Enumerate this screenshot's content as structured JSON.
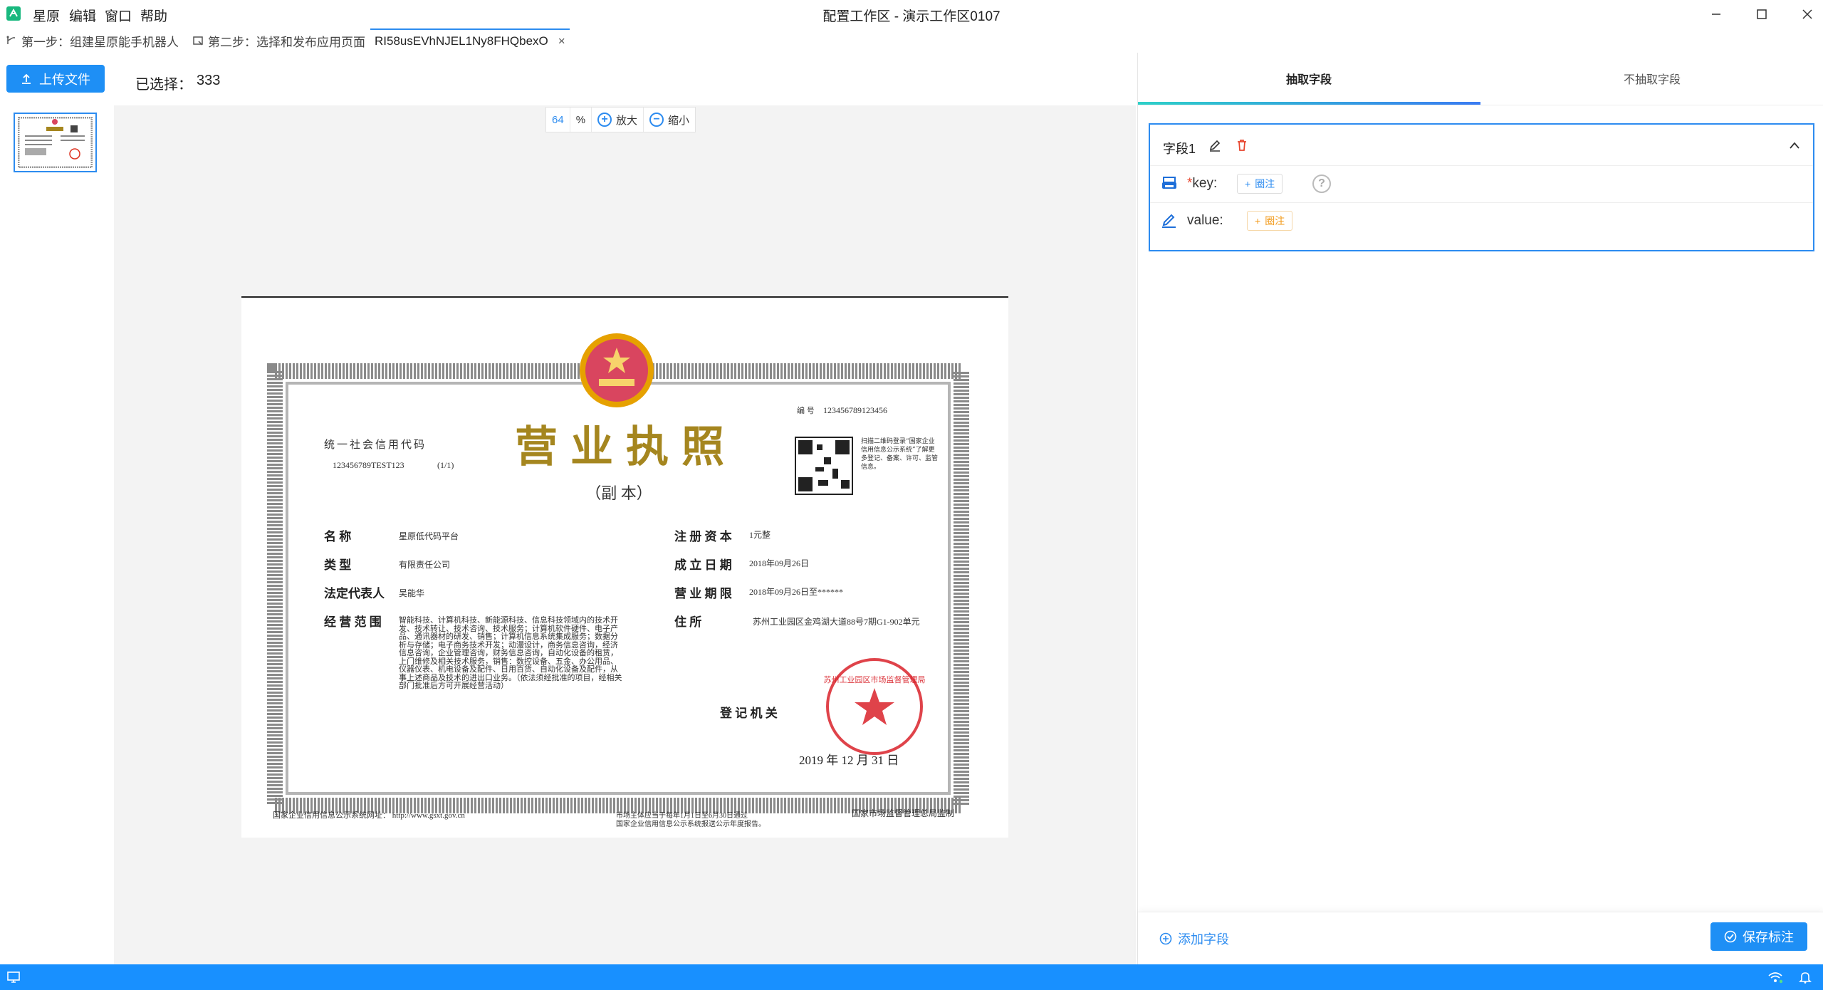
{
  "titlebar": {
    "menu": [
      "星原",
      "编辑",
      "窗口",
      "帮助"
    ],
    "title": "配置工作区 - 演示工作区0107"
  },
  "tabs": [
    {
      "label": "第一步：组建星原能手机器人",
      "icon": "robot-branch-icon"
    },
    {
      "label": "第二步：选择和发布应用页面",
      "icon": "page-publish-icon"
    },
    {
      "label": "RI58usEVhNJEL1Ny8FHQbexO",
      "close": "×"
    }
  ],
  "toolbar": {
    "upload_label": "上传文件",
    "selected_label": "已选择：",
    "selected_count": "333"
  },
  "zoom": {
    "value": "64",
    "unit": "%",
    "zoom_in": "放大",
    "zoom_out": "缩小"
  },
  "document": {
    "heading": "营业执照",
    "subheading": "（副  本）",
    "serial_label": "编  号",
    "serial_value": "123456789123456",
    "credit_code_label": "统一社会信用代码",
    "credit_code_value": "123456789TEST123",
    "credit_code_suffix": "(1/1)",
    "qr_note": "扫描二维码登录“国家企业信用信息公示系统”了解更多登记、备案、许可、监管信息。",
    "left_fields": [
      {
        "label": "名        称",
        "value": "星原低代码平台"
      },
      {
        "label": "类        型",
        "value": "有限责任公司"
      },
      {
        "label": "法定代表人",
        "value": "吴能华"
      },
      {
        "label": "经 营 范 围",
        "value": "智能科技、计算机科技、新能源科技、信息科技领域内的技术开发、技术转让、技术咨询、技术服务；计算机软件硬件、电子产品、通讯器材的研发、销售；计算机信息系统集成服务；数据分析与存储；电子商务技术开发；动漫设计，商务信息咨询，经济信息咨询，企业管理咨询，财务信息咨询，自动化设备的租赁，上门维修及相关技术服务，销售：数控设备、五金、办公用品、仪器仪表、机电设备及配件、日用百货、自动化设备及配件，从事上述商品及技术的进出口业务。（依法须经批准的项目，经相关部门批准后方可开展经营活动）"
      }
    ],
    "right_fields": [
      {
        "label": "注 册 资 本",
        "value": "1元整"
      },
      {
        "label": "成 立 日 期",
        "value": "2018年09月26日"
      },
      {
        "label": "营 业 期 限",
        "value": "2018年09月26日至******"
      },
      {
        "label": "住        所",
        "value": "苏州工业园区金鸡湖大道88号7期G1-902单元"
      }
    ],
    "registry_label": "登 记 机 关",
    "issue_date": "2019 年 12 月 31 日",
    "seal_text": "苏州工业园区市场监督管理局",
    "footer_left": "国家企业信用信息公示系统网址：    http://www.gsxt.gov.cn",
    "footer_mid_1": "市场主体应当于每年1月1日至6月30日通过",
    "footer_mid_2": "国家企业信用信息公示系统报送公示年度报告。",
    "footer_right": "国家市场监督管理总局监制"
  },
  "right_panel": {
    "tabs": [
      "抽取字段",
      "不抽取字段"
    ],
    "field": {
      "name": "字段1",
      "rows": [
        {
          "required_mark": "*",
          "label": "key:",
          "button": "圈注"
        },
        {
          "label": "value:",
          "button": "圈注"
        }
      ]
    },
    "add_field": "添加字段",
    "save": "保存标注"
  },
  "colors": {
    "accent": "#1890ff",
    "app_logo": "#18b87e",
    "delete": "#e8462e",
    "annotate_value": "#f29a1a",
    "title_gold": "#a5861f"
  }
}
